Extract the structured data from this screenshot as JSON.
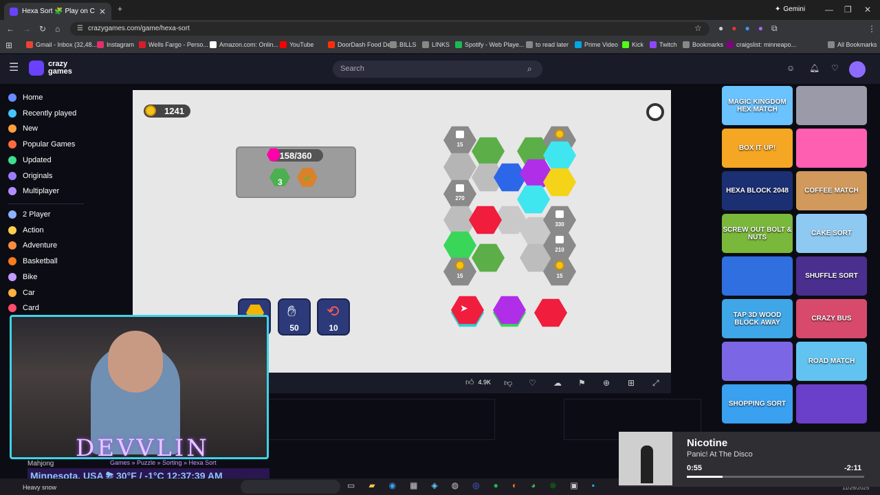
{
  "browser": {
    "tab_title": "Hexa Sort 🧩 Play on CrazyGames",
    "gemini_label": "Gemini",
    "url": "crazygames.com/game/hexa-sort"
  },
  "bookmarks": [
    {
      "label": "Gmail - Inbox (32,48...",
      "color": "#ea4335"
    },
    {
      "label": "Instagram",
      "color": "#e1306c"
    },
    {
      "label": "Wells Fargo - Perso...",
      "color": "#d71e28"
    },
    {
      "label": "Amazon.com: Onlin...",
      "color": "#ffffff"
    },
    {
      "label": "YouTube",
      "color": "#ff0000"
    },
    {
      "label": "DoorDash Food Deli...",
      "color": "#ff3008"
    },
    {
      "label": "BILLS",
      "color": "#888888"
    },
    {
      "label": "LINKS",
      "color": "#888888"
    },
    {
      "label": "Spotify - Web Playe...",
      "color": "#1db954"
    },
    {
      "label": "to read later",
      "color": "#888888"
    },
    {
      "label": "Prime Video",
      "color": "#00a8e1"
    },
    {
      "label": "Kick",
      "color": "#53fc18"
    },
    {
      "label": "Twitch",
      "color": "#9146ff"
    },
    {
      "label": "Bookmarks",
      "color": "#888888"
    },
    {
      "label": "craigslist: minneapo...",
      "color": "#800080"
    }
  ],
  "all_bookmarks": "All Bookmarks",
  "site": {
    "logo_line1": "crazy",
    "logo_line2": "games",
    "search_placeholder": "Search"
  },
  "sidebar": {
    "items": [
      {
        "label": "Home",
        "color": "#6b8cff"
      },
      {
        "label": "Recently played",
        "color": "#45c6ff"
      },
      {
        "label": "New",
        "color": "#ff9f3d"
      },
      {
        "label": "Popular Games",
        "color": "#ff6b3d"
      },
      {
        "label": "Updated",
        "color": "#3de08c"
      },
      {
        "label": "Originals",
        "color": "#9d7bff"
      },
      {
        "label": "Multiplayer",
        "color": "#b28cff"
      }
    ],
    "categories": [
      {
        "label": "2 Player",
        "color": "#8fb3ff"
      },
      {
        "label": "Action",
        "color": "#ffcf4d"
      },
      {
        "label": "Adventure",
        "color": "#ff8c3d"
      },
      {
        "label": "Basketball",
        "color": "#ff7a1a"
      },
      {
        "label": "Bike",
        "color": "#c49cff"
      },
      {
        "label": "Car",
        "color": "#ffb13d"
      },
      {
        "label": "Card",
        "color": "#ff4d6d"
      }
    ],
    "hidden_item": "Mahjong"
  },
  "game": {
    "coins": "1241",
    "goal_progress": "158/360",
    "goal_count": "3",
    "cell_labels": [
      "15",
      "15",
      "270",
      "330",
      "210",
      "15",
      "15"
    ],
    "boosters": [
      {
        "name": "rocket",
        "count": ""
      },
      {
        "name": "hand",
        "count": "50"
      },
      {
        "name": "swap",
        "count": "10"
      }
    ]
  },
  "gamebar": {
    "likes": "4.9K"
  },
  "right_rail": [
    {
      "label": "MAGIC KINGDOM HEX MATCH",
      "color": "#6ac3ff"
    },
    {
      "label": "",
      "color": "#9a9aa8"
    },
    {
      "label": "BOX IT UP!",
      "color": "#f5a623"
    },
    {
      "label": "",
      "color": "#ff5fb0"
    },
    {
      "label": "HEXA BLOCK 2048",
      "color": "#1b2f73"
    },
    {
      "label": "COFFEE MATCH",
      "color": "#d19a5c"
    },
    {
      "label": "SCREW OUT BOLT & NUTS",
      "color": "#7ab83b"
    },
    {
      "label": "CAKE SORT",
      "color": "#8ec9f2"
    },
    {
      "label": "",
      "color": "#2f6fe0"
    },
    {
      "label": "SHUFFLE SORT",
      "color": "#4a2f8f"
    },
    {
      "label": "TAP 3D WOOD BLOCK AWAY",
      "color": "#3fa6e8"
    },
    {
      "label": "CRAZY BUS",
      "color": "#d84a6b"
    },
    {
      "label": "",
      "color": "#7b67e6"
    },
    {
      "label": "ROAD MATCH",
      "color": "#62c3f0"
    },
    {
      "label": "SHOPPING SORT",
      "color": "#3aa0f0"
    },
    {
      "label": "",
      "color": "#6a3fc9"
    }
  ],
  "stream": {
    "logo": "DEVVLIN",
    "breadcrumbs": "Games » Puzzle » Sorting » Hexa Sort",
    "weather": "Minnesota, USA ⛈ 30°F / -1°C 12:37:39 AM"
  },
  "music": {
    "title": "Nicotine",
    "artist": "Panic! At The Disco",
    "elapsed": "0:55",
    "remaining": "-2:11",
    "progress": 0.2
  },
  "taskbar": {
    "weather_label": "Heavy snow",
    "date": "11/26/2025"
  }
}
